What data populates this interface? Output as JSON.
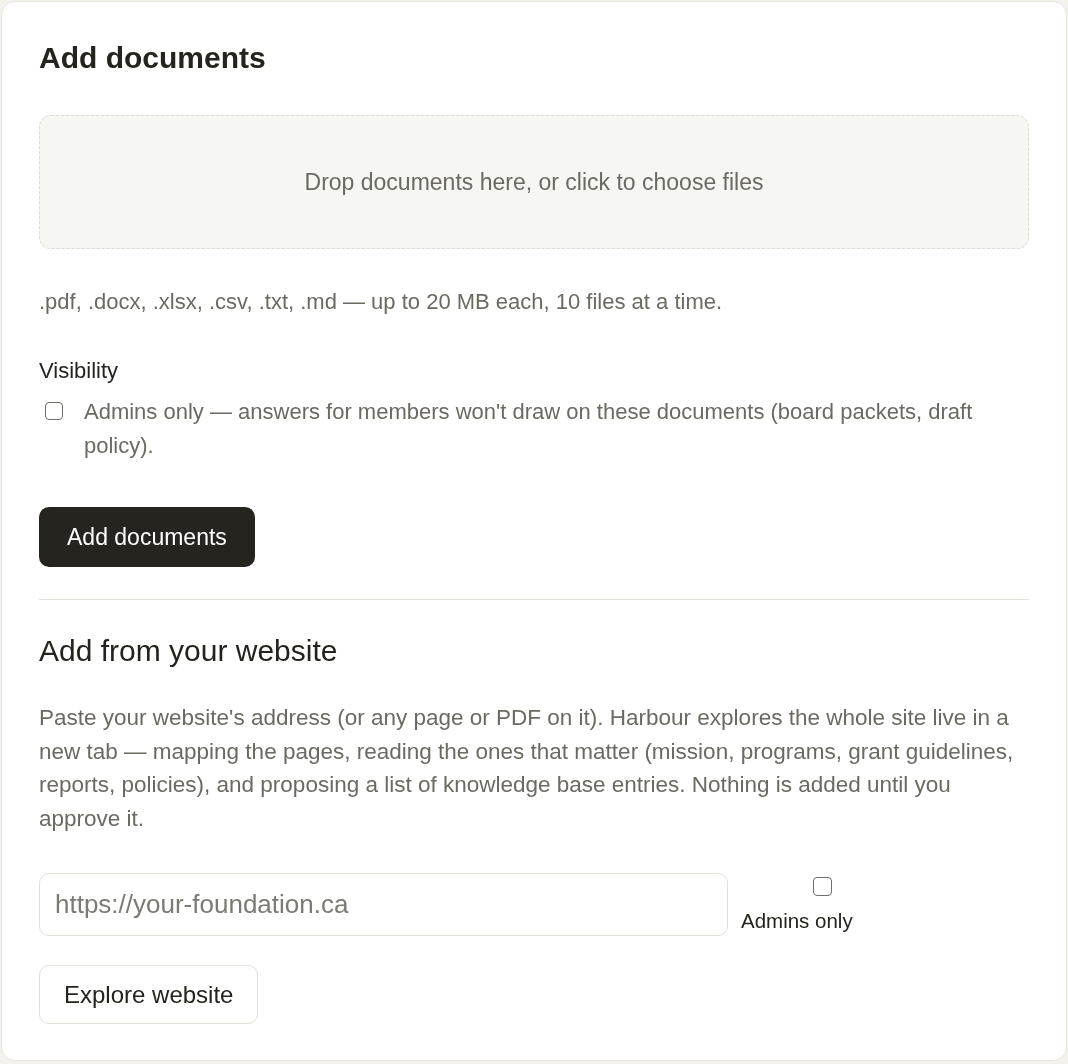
{
  "upload": {
    "title": "Add documents",
    "dropzone": {
      "text": "Drop documents here, or click to choose files"
    },
    "hint": ".pdf, .docx, .xlsx, .csv, .txt, .md — up to 20 MB each, 10 files at a time.",
    "visibility": {
      "label": "Visibility",
      "option": {
        "label": "Admins only — answers for members won't draw on these documents (board packets, draft policy).",
        "checked": false
      }
    },
    "button": "Add documents"
  },
  "website": {
    "title": "Add from your website",
    "description": "Paste your website's address (or any page or PDF on it). Harbour explores the whole site live in a new tab — mapping the pages, reading the ones that matter (mission, programs, grant guidelines, reports, policies), and proposing a list of knowledge base entries. Nothing is added until you approve it.",
    "url_field": {
      "placeholder": "https://your-foundation.ca"
    },
    "admins_only": {
      "label": "Admins only",
      "checked": false
    },
    "button": "Explore website"
  }
}
